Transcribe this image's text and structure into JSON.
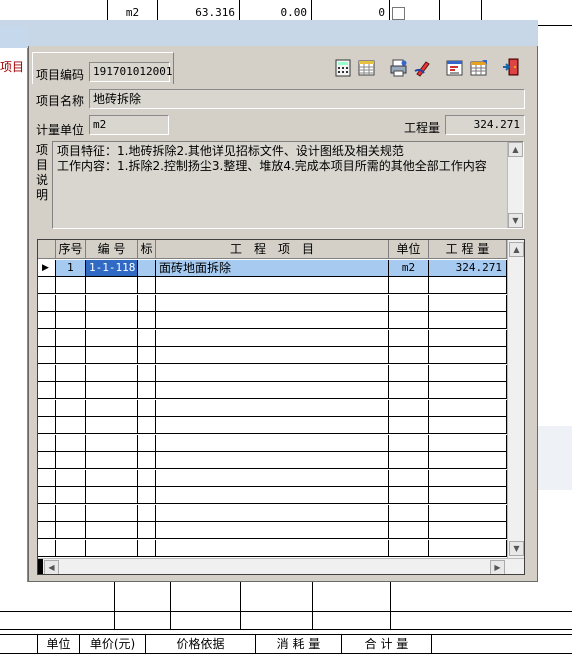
{
  "background_top_row": {
    "unit": "m2",
    "value1": "63.316",
    "value2": "0.00",
    "value3": "0"
  },
  "left_window": {
    "label": "项目"
  },
  "dialog": {
    "code_label": "项目编码",
    "code_value": "191701012001",
    "name_label": "项目名称",
    "name_value": "地砖拆除",
    "unit_label": "计量单位",
    "unit_value": "m2",
    "quantity_label": "工程量",
    "quantity_value": "324.271",
    "desc_label": "项目说明",
    "desc_lines": [
      "项目特征：1.地砖拆除2.其他详见招标文件、设计图纸及相关规范",
      "工作内容：1.拆除2.控制扬尘3.整理、堆放4.完成本项目所需的其他全部工作内容"
    ],
    "toolbar_icons": [
      "calculator-icon",
      "table-icon",
      "print-icon",
      "edit-pen-icon",
      "chart-icon",
      "grid-icon",
      "exit-icon"
    ]
  },
  "grid": {
    "columns": [
      "序号",
      "编 号",
      "标",
      "工　程　项　目",
      "单位",
      "工 程 量"
    ],
    "rows": [
      {
        "seq": "1",
        "code": "1-1-118",
        "flag": "",
        "item": "面砖地面拆除",
        "unit": "m2",
        "qty": "324.271"
      }
    ],
    "empty_rows": 16
  },
  "bottom_header": {
    "columns": [
      "单位",
      "单价(元)",
      "价格依据",
      "消 耗 量",
      "合 计 量"
    ]
  },
  "colors": {
    "dialog_bg": "#d4d0c8",
    "selection": "#a6caf0",
    "code_highlight": "#316ac5",
    "frame_blue": "#c7d7e8",
    "left_label_red": "#a00000"
  }
}
